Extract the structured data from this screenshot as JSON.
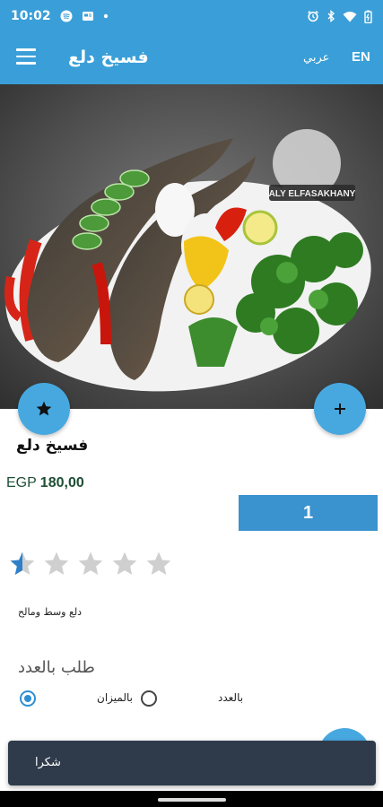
{
  "status_bar": {
    "time": "10:02"
  },
  "app_bar": {
    "title": "فسيخ دلع",
    "lang_ar": "عربي",
    "lang_en": "EN"
  },
  "product": {
    "name": "فسيخ دلع",
    "currency": "EGP",
    "price": "180,00",
    "quantity": "1",
    "rating": 0.5,
    "rating_max": 5,
    "description": "دلع وسط ومالح"
  },
  "order": {
    "label": "طلب بالعدد",
    "options": [
      {
        "label": "بالعدد",
        "selected": true
      },
      {
        "label": "بالميزان",
        "selected": false
      }
    ]
  },
  "image_logo_text": "ALY ELFASAKHANY",
  "snackbar": {
    "message": "شكرا"
  },
  "colors": {
    "accent": "#3a9fd8",
    "fab": "#47a8e0",
    "qty": "#3a92ce",
    "price": "#1f4e35",
    "snackbar": "#2f3b4b"
  }
}
